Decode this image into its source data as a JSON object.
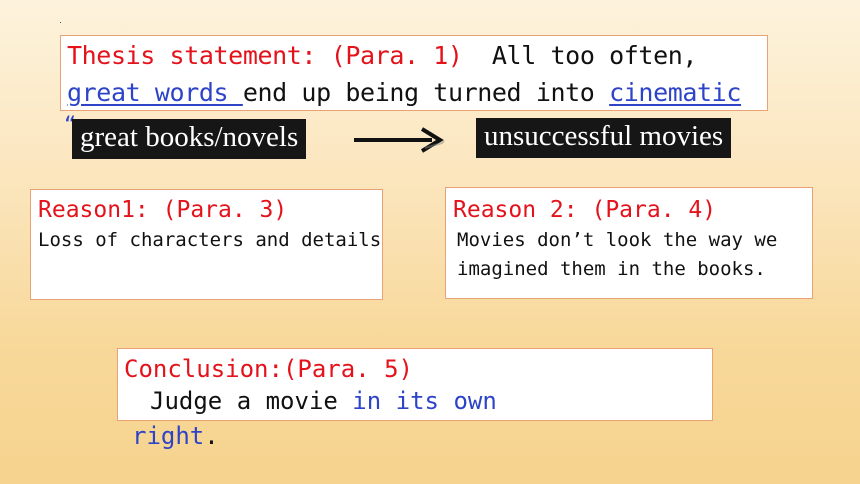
{
  "slide": {
    "thesis": {
      "label": "Thesis statement: (Para. 1)",
      "text_1": "All too often,",
      "link_1": "great words ",
      "text_2": "end up being turned into ",
      "link_2": "cinematic",
      "overflow_fragment": "“"
    },
    "flow": {
      "from": "great books/novels",
      "to": "unsuccessful movies",
      "arrow_icon": "arrow-right-icon"
    },
    "reason1": {
      "heading": "Reason1: (Para. 3)",
      "body": "Loss of characters and details"
    },
    "reason2": {
      "heading": "Reason 2: (Para. 4)",
      "body_line_1": "Movies don’t look the way we",
      "body_line_2": "imagined them in the books."
    },
    "conclusion": {
      "heading": "Conclusion:(Para. 5)",
      "text_1": "Judge a movie ",
      "highlight_1": "in its own",
      "highlight_2": "right",
      "text_2": "."
    }
  },
  "colors": {
    "heading_red": "#e3121b",
    "link_blue": "#2e44c8",
    "box_border": "#e8a276",
    "tag_background": "#161616"
  }
}
